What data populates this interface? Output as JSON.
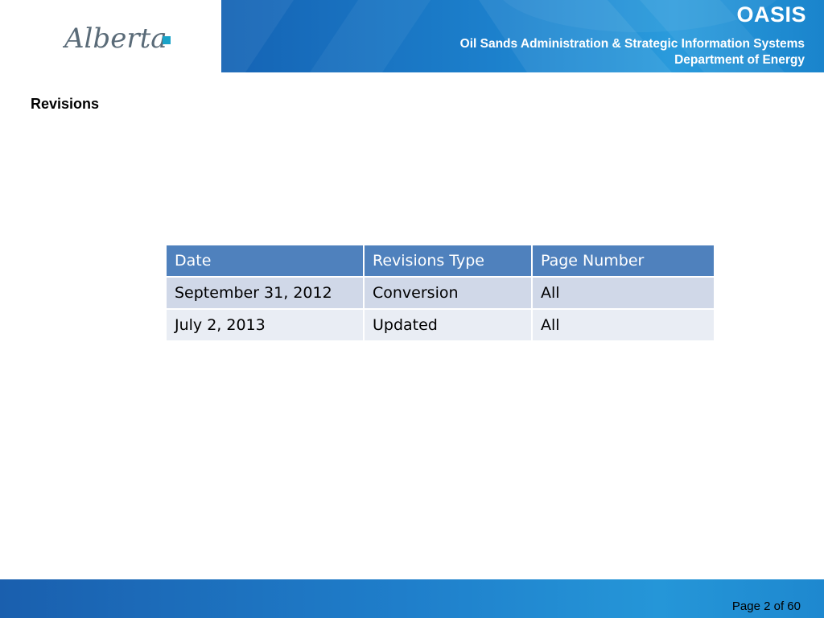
{
  "header": {
    "logo_text": "Alberta",
    "title": "OASIS",
    "subtitle_line1": "Oil Sands Administration & Strategic Information Systems",
    "subtitle_line2": "Department of Energy",
    "colors": {
      "banner": "#1c80cc",
      "logo_accent": "#1aa3c8",
      "logo_text": "#5a6b78"
    }
  },
  "section": {
    "title": "Revisions"
  },
  "table": {
    "headers": [
      "Date",
      "Revisions Type",
      "Page Number"
    ],
    "rows": [
      [
        "September 31, 2012",
        "Conversion",
        "All"
      ],
      [
        "July 2, 2013",
        "Updated",
        "All"
      ]
    ],
    "colors": {
      "header": "#4f81bd",
      "row_odd": "#d0d8e8",
      "row_even": "#e9edf4"
    }
  },
  "footer": {
    "page_label": "Page 2 of 60"
  }
}
